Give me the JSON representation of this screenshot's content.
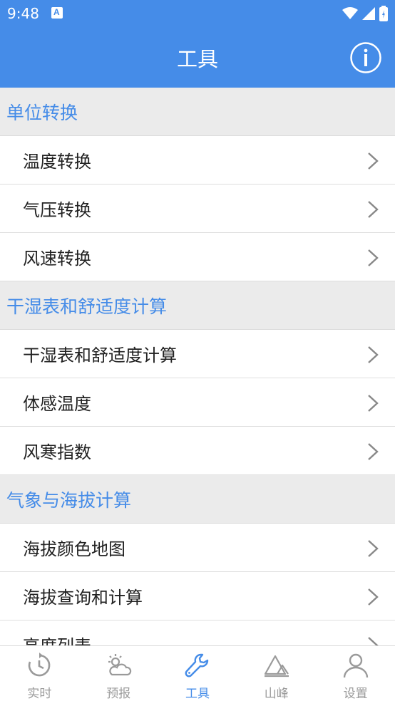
{
  "status": {
    "time": "9:48"
  },
  "appbar": {
    "title": "工具"
  },
  "sections": [
    {
      "title": "单位转换",
      "items": [
        "温度转换",
        "气压转换",
        "风速转换"
      ]
    },
    {
      "title": "干湿表和舒适度计算",
      "items": [
        "干湿表和舒适度计算",
        "体感温度",
        "风寒指数"
      ]
    },
    {
      "title": "气象与海拔计算",
      "items": [
        "海拔颜色地图",
        "海拔查询和计算",
        "高度列表"
      ]
    }
  ],
  "tabs": [
    {
      "label": "实时",
      "icon": "refresh-clock-icon"
    },
    {
      "label": "预报",
      "icon": "sun-cloud-icon"
    },
    {
      "label": "工具",
      "icon": "wrench-icon",
      "active": true
    },
    {
      "label": "山峰",
      "icon": "mountain-icon"
    },
    {
      "label": "设置",
      "icon": "person-icon"
    }
  ],
  "colors": {
    "accent": "#458ce8",
    "section_bg": "#ebebeb",
    "inactive": "#9a9a9a"
  }
}
